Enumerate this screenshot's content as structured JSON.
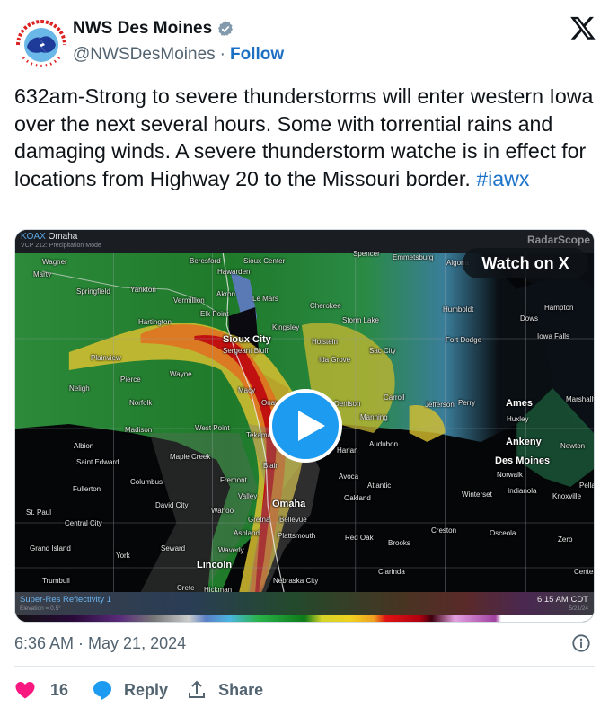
{
  "author": {
    "display_name": "NWS Des Moines",
    "handle": "@NWSDesMoines",
    "separator": "·",
    "follow_label": "Follow",
    "verified": true,
    "avatar_icon": "nws-logo-icon"
  },
  "platform_icon": "x-logo-icon",
  "tweet": {
    "text": "632am-Strong to severe thunderstorms will enter western Iowa over the next several hours. Some with torrential rains and damaging winds. A severe thunderstorm watche is in effect for locations from Highway 20 to the Missouri border. ",
    "hashtag": "#iawx",
    "hashtag_color": "#1d9bf0"
  },
  "media": {
    "type": "video",
    "watch_label": "Watch on X",
    "play_icon": "play-icon",
    "radar": {
      "site_code": "KOAX",
      "site_name": "Omaha",
      "mode": "VCP 212: Precipitation Mode",
      "brand": "RadarScope",
      "product": "Super-Res Reflectivity 1",
      "elevation": "Elevation = 0.5°",
      "time": "6:15 AM CDT",
      "date": "5/21/24",
      "cities": [
        {
          "name": "Wagner"
        },
        {
          "name": "Marty"
        },
        {
          "name": "Springfield"
        },
        {
          "name": "Yankton"
        },
        {
          "name": "Beresford"
        },
        {
          "name": "Sioux Center"
        },
        {
          "name": "Hawarden"
        },
        {
          "name": "Vermillion"
        },
        {
          "name": "Akron"
        },
        {
          "name": "Le Mars"
        },
        {
          "name": "Elk Point"
        },
        {
          "name": "Hartington"
        },
        {
          "name": "Kingsley"
        },
        {
          "name": "Sioux City"
        },
        {
          "name": "Sergeant Bluff"
        },
        {
          "name": "Plainview"
        },
        {
          "name": "Pierce"
        },
        {
          "name": "Wayne"
        },
        {
          "name": "Neligh"
        },
        {
          "name": "Norfolk"
        },
        {
          "name": "Macy"
        },
        {
          "name": "Onawa"
        },
        {
          "name": "Spencer"
        },
        {
          "name": "Emmetsburg"
        },
        {
          "name": "Algona"
        },
        {
          "name": "Cherokee"
        },
        {
          "name": "Storm Lake"
        },
        {
          "name": "Humboldt"
        },
        {
          "name": "Hampton"
        },
        {
          "name": "Dows"
        },
        {
          "name": "Iowa Falls"
        },
        {
          "name": "Holstein"
        },
        {
          "name": "Sac City"
        },
        {
          "name": "Ida Grove"
        },
        {
          "name": "Fort Dodge"
        },
        {
          "name": "Carroll"
        },
        {
          "name": "Denison"
        },
        {
          "name": "Jefferson"
        },
        {
          "name": "Ames"
        },
        {
          "name": "Marshalltown"
        },
        {
          "name": "Manning"
        },
        {
          "name": "Huxley"
        },
        {
          "name": "Perry"
        },
        {
          "name": "Madison"
        },
        {
          "name": "West Point"
        },
        {
          "name": "Tekamah"
        },
        {
          "name": "Albion"
        },
        {
          "name": "Saint Edward"
        },
        {
          "name": "Maple Creek"
        },
        {
          "name": "Blair"
        },
        {
          "name": "Audubon"
        },
        {
          "name": "Harlan"
        },
        {
          "name": "Ankeny"
        },
        {
          "name": "Newton"
        },
        {
          "name": "Des Moines"
        },
        {
          "name": "Columbus"
        },
        {
          "name": "Fremont"
        },
        {
          "name": "Fullerton"
        },
        {
          "name": "Valley"
        },
        {
          "name": "Omaha"
        },
        {
          "name": "David City"
        },
        {
          "name": "Wahoo"
        },
        {
          "name": "Avoca"
        },
        {
          "name": "Atlantic"
        },
        {
          "name": "Oakland"
        },
        {
          "name": "Norwalk"
        },
        {
          "name": "Winterset"
        },
        {
          "name": "Indianola"
        },
        {
          "name": "Knoxville"
        },
        {
          "name": "Pella"
        },
        {
          "name": "St. Paul"
        },
        {
          "name": "Central City"
        },
        {
          "name": "Gretna"
        },
        {
          "name": "Bellevue"
        },
        {
          "name": "Grand Island"
        },
        {
          "name": "Ashland"
        },
        {
          "name": "Plattsmouth"
        },
        {
          "name": "Red Oak"
        },
        {
          "name": "Creston"
        },
        {
          "name": "Osceola"
        },
        {
          "name": "Brooks"
        },
        {
          "name": "Zero"
        },
        {
          "name": "Seward"
        },
        {
          "name": "Waverly"
        },
        {
          "name": "York"
        },
        {
          "name": "Lincoln"
        },
        {
          "name": "Clarinda"
        },
        {
          "name": "Centerville"
        },
        {
          "name": "Trumbull"
        },
        {
          "name": "Crete"
        },
        {
          "name": "Hickman"
        },
        {
          "name": "Nebraska City"
        }
      ]
    }
  },
  "footer": {
    "timestamp": "6:36 AM · May 21, 2024",
    "info_icon": "info-icon"
  },
  "actions": {
    "like_count": "16",
    "reply_label": "Reply",
    "share_label": "Share",
    "like_color": "#f91880",
    "reply_color": "#1d9bf0"
  }
}
